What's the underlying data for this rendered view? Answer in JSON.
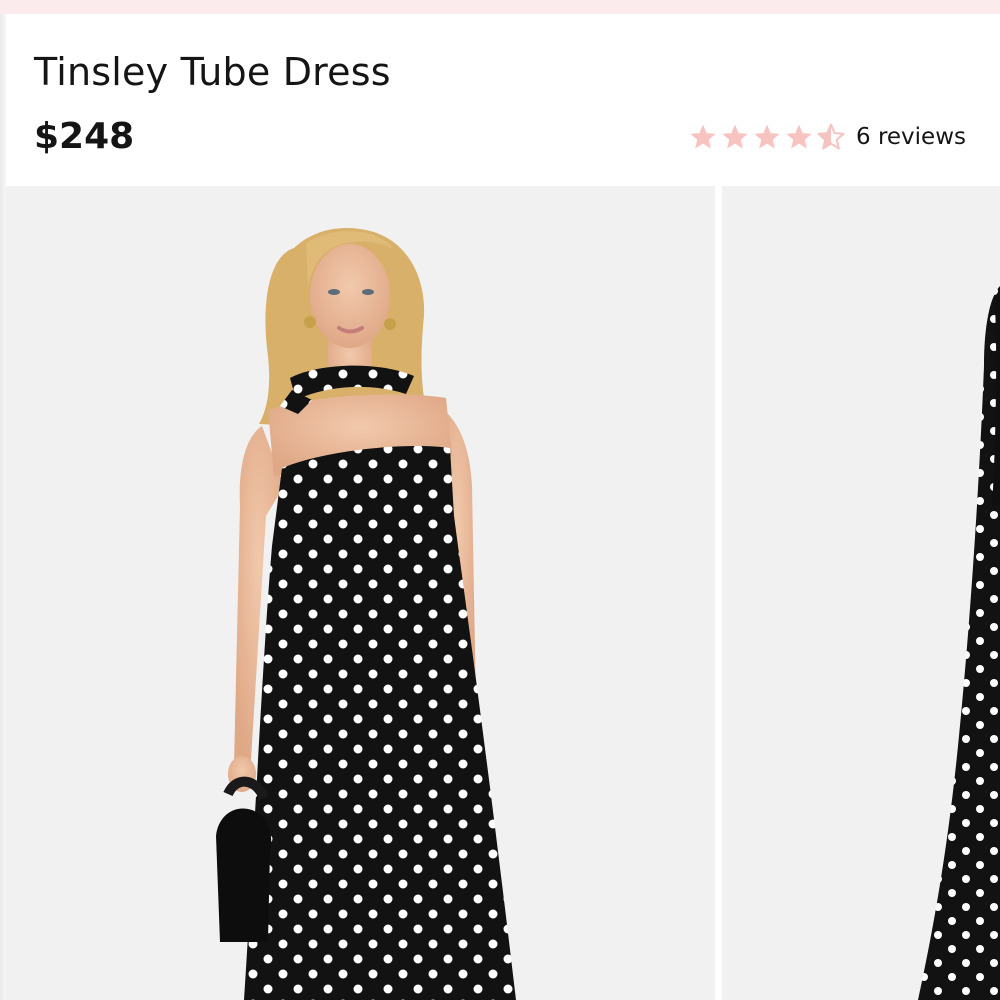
{
  "product": {
    "title": "Tinsley Tube Dress",
    "price": "$248",
    "rating_value": 4.5,
    "rating_max": 5,
    "reviews_label": "6 reviews"
  },
  "colors": {
    "accent_pink": "#f6c3c0",
    "top_strip": "#fcebec",
    "text": "#151515",
    "gallery_bg": "#f1f1f1"
  },
  "gallery": {
    "images": [
      {
        "alt": "model-front-view"
      },
      {
        "alt": "model-back-view"
      }
    ]
  }
}
